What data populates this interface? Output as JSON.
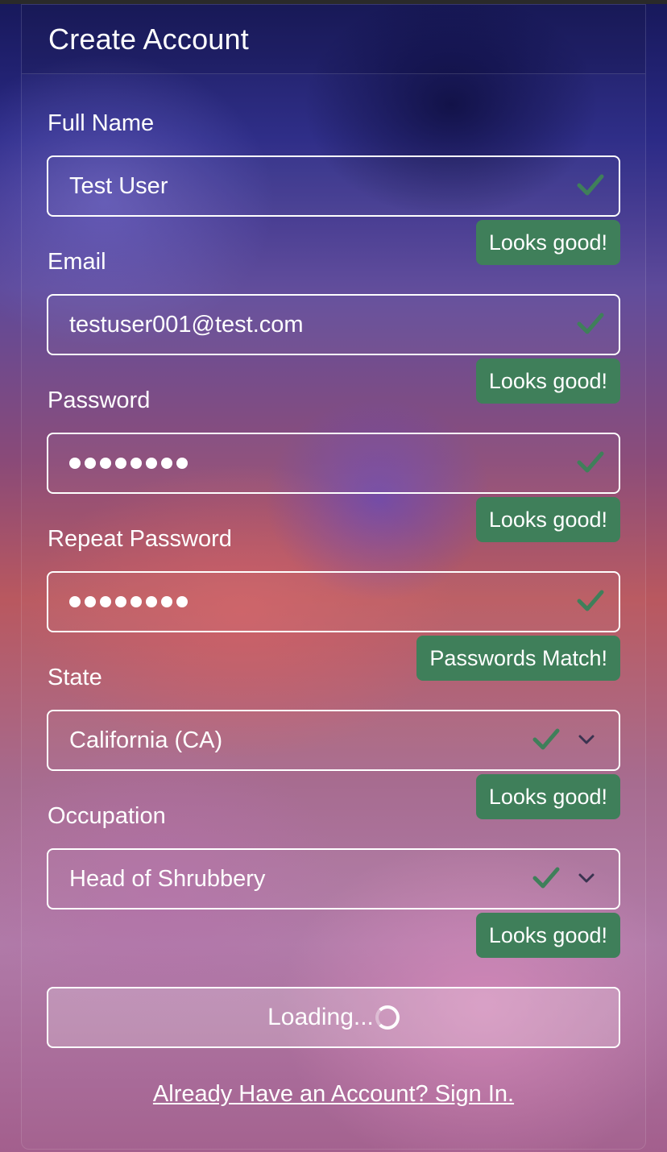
{
  "header": {
    "title": "Create Account"
  },
  "fields": {
    "full_name": {
      "label": "Full Name",
      "value": "Test User",
      "feedback": "Looks good!"
    },
    "email": {
      "label": "Email",
      "value": "testuser001@test.com",
      "feedback": "Looks good!"
    },
    "password": {
      "label": "Password",
      "masked_length": 8,
      "feedback": "Looks good!"
    },
    "repeat_password": {
      "label": "Repeat Password",
      "masked_length": 8,
      "feedback": "Passwords Match!"
    },
    "state": {
      "label": "State",
      "value": "California (CA)",
      "feedback": "Looks good!"
    },
    "occupation": {
      "label": "Occupation",
      "value": "Head of Shrubbery",
      "feedback": "Looks good!"
    }
  },
  "submit": {
    "label": "Loading..."
  },
  "signin_link": {
    "label": "Already Have an Account? Sign In."
  },
  "colors": {
    "valid_badge": "#3f7f5a",
    "check_icon": "#3f7f5a",
    "field_border": "#ffffff"
  },
  "icons": {
    "valid": "checkmark-icon",
    "dropdown": "chevron-down-icon",
    "loading": "spinner-icon"
  }
}
